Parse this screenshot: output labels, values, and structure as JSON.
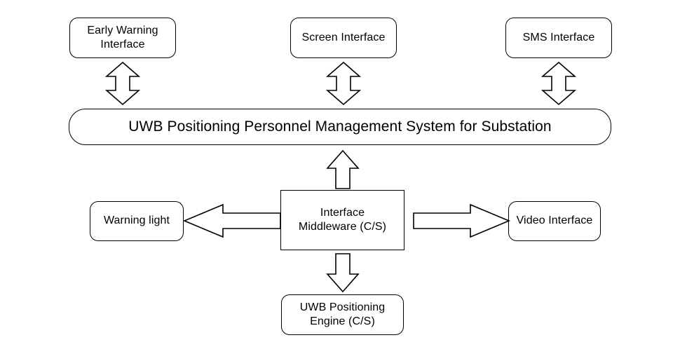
{
  "diagram": {
    "title": "UWB Positioning Personnel Management System for Substation architecture",
    "stroke_color": "#000000",
    "fill_color": "#ffffff",
    "background": "#ffffff",
    "nodes": {
      "early_warning_interface": "Early Warning\nInterface",
      "screen_interface": "Screen Interface",
      "sms_interface": "SMS Interface",
      "main_system": "UWB Positioning Personnel Management System for Substation",
      "warning_light": "Warning light",
      "interface_middleware": "Interface\nMiddleware (C/S)",
      "video_interface": "Video Interface",
      "positioning_engine": "UWB Positioning\nEngine (C/S)"
    },
    "connectors": {
      "early_warning_link": "double-headed-vertical-arrow",
      "screen_link": "double-headed-vertical-arrow",
      "sms_link": "double-headed-vertical-arrow",
      "middleware_to_system": "up-arrow",
      "middleware_to_warning_light": "left-arrow",
      "middleware_to_video": "right-arrow",
      "middleware_to_engine": "down-arrow"
    }
  }
}
